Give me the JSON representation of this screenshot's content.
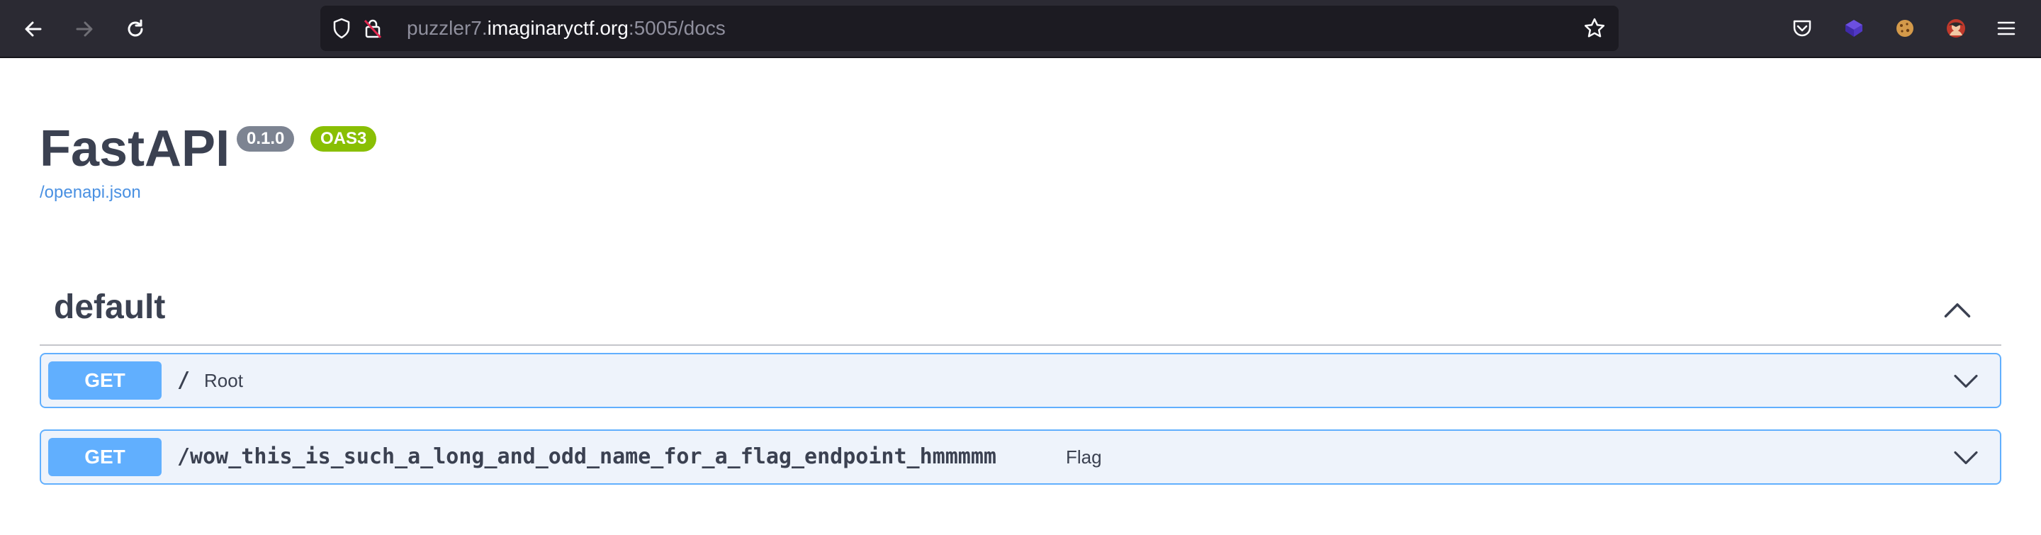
{
  "browser": {
    "url": {
      "prefix": "puzzler7.",
      "host": "imaginaryctf.org",
      "suffix": ":5005/docs"
    },
    "icons": [
      "back-icon",
      "forward-icon",
      "reload-icon",
      "shield-icon",
      "insecure-lock-icon",
      "bookmark-star-icon",
      "pocket-icon",
      "extension-cube-icon",
      "extension-cookie-icon",
      "extension-avatar-icon",
      "menu-icon"
    ]
  },
  "api": {
    "title": "FastAPI",
    "version": "0.1.0",
    "oas": "OAS3",
    "spec_link": "/openapi.json"
  },
  "section": {
    "title": "default",
    "expanded": true
  },
  "operations": [
    {
      "method": "GET",
      "path": "/",
      "summary": "Root"
    },
    {
      "method": "GET",
      "path": "/wow_this_is_such_a_long_and_odd_name_for_a_flag_endpoint_hmmmmm",
      "summary": "Flag"
    }
  ],
  "colors": {
    "get": "#61affe",
    "get_bg": "#eef3fb",
    "version_badge": "#7d8492",
    "oas_badge": "#89bf04",
    "link": "#4990e2",
    "text": "#3b4151",
    "toolbar": "#2b2a33"
  }
}
